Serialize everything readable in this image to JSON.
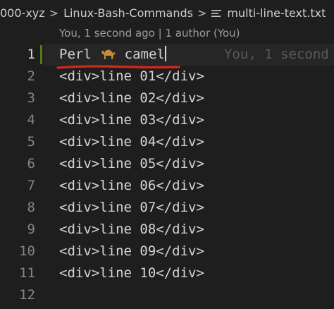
{
  "breadcrumb": {
    "root": "000-xyz",
    "folder": "Linux-Bash-Commands",
    "file": "multi-line-text.txt",
    "separator": ">"
  },
  "codelens": {
    "text": "You, 1 second ago | 1 author (You)"
  },
  "editor": {
    "active_line": 1,
    "inline_blame": "You, 1 second",
    "line_numbers": [
      "1",
      "2",
      "3",
      "4",
      "5",
      "6",
      "7",
      "8",
      "9",
      "10",
      "11",
      "12"
    ],
    "lines": {
      "l1_before": "Perl ",
      "l1_after": " camel",
      "l2": "<div>line 01</div>",
      "l3": "<div>line 02</div>",
      "l4": "<div>line 03</div>",
      "l5": "<div>line 04</div>",
      "l6": "<div>line 05</div>",
      "l7": "<div>line 06</div>",
      "l8": "<div>line 07</div>",
      "l9": "<div>line 08</div>",
      "l10": "<div>line 09</div>",
      "l11": "<div>line 10</div>",
      "l12": ""
    },
    "icons": {
      "line1_emoji": "camel-icon",
      "file": "file-lines-icon"
    }
  },
  "colors": {
    "background": "#1e1e1e",
    "modified_gutter": "#587c0c",
    "annotation_underline": "#d9261c"
  }
}
